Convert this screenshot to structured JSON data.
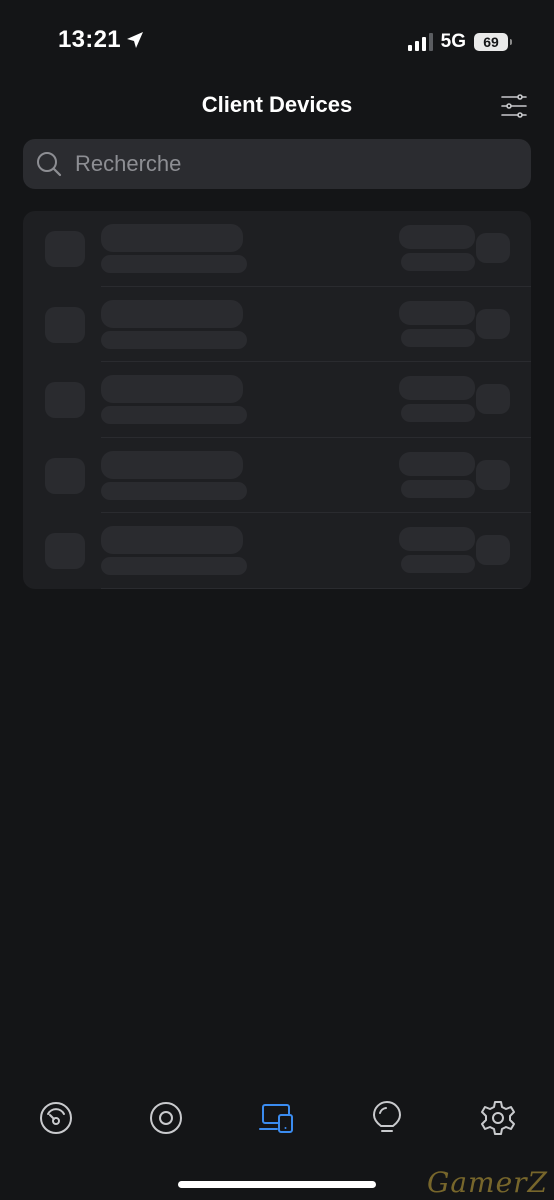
{
  "status_bar": {
    "time": "13:21",
    "network": "5G",
    "battery": "69"
  },
  "header": {
    "title": "Client Devices"
  },
  "search": {
    "placeholder": "Recherche"
  },
  "device_list": {
    "state": "loading",
    "placeholder_rows": 5
  },
  "tab_bar": {
    "active_tab": "devices",
    "tabs": [
      {
        "id": "dashboard",
        "icon": "speedometer-icon"
      },
      {
        "id": "topology",
        "icon": "target-icon"
      },
      {
        "id": "devices",
        "icon": "devices-icon"
      },
      {
        "id": "insights",
        "icon": "lightbulb-icon"
      },
      {
        "id": "settings",
        "icon": "gear-icon"
      }
    ]
  },
  "colors": {
    "background": "#141517",
    "card": "#1e1f22",
    "skeleton": "#2a2b2f",
    "search_bg": "#2b2c30",
    "accent": "#3b8cf0",
    "icon_inactive": "#c9cacd"
  },
  "watermark": "GamerZ"
}
